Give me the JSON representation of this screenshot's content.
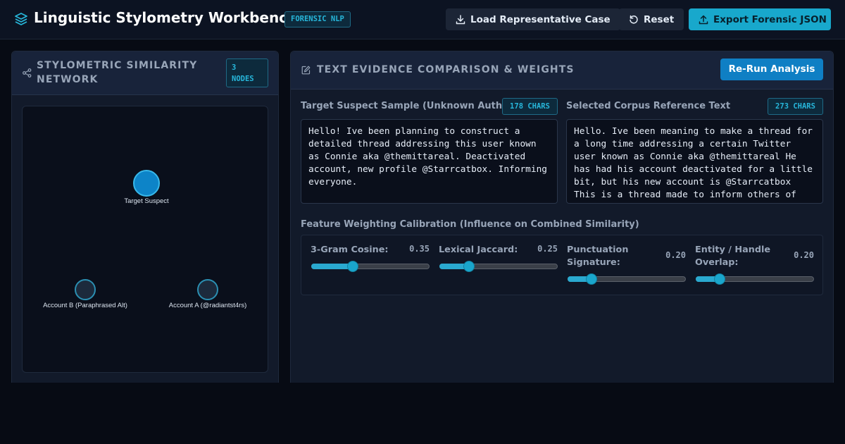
{
  "header": {
    "title": "Linguistic Stylometry Workbench",
    "badge": "FORENSIC NLP",
    "load_label": "Load Representative Case",
    "reset_label": "Reset",
    "export_label": "Export Forensic JSON"
  },
  "network_panel": {
    "title": "STYLOMETRIC SIMILARITY NETWORK",
    "node_count": "3 NODES",
    "nodes": [
      {
        "label": "Target Suspect",
        "role": "target"
      },
      {
        "label": "Account B (Paraphrased Alt)",
        "role": "corpus"
      },
      {
        "label": "Account A (@radiantst4rs)",
        "role": "corpus"
      }
    ]
  },
  "comparison_panel": {
    "title": "TEXT EVIDENCE COMPARISON & WEIGHTS",
    "rerun_label": "Re-Run Analysis",
    "target": {
      "label": "Target Suspect Sample (Unknown Author)",
      "chars": "178 CHARS",
      "text": "Hello! Ive been planning to construct a detailed thread addressing this user known as Connie aka @themittareal. Deactivated account, new profile @Starrcatbox. Informing everyone."
    },
    "reference": {
      "label": "Selected Corpus Reference Text",
      "chars": "273 CHARS",
      "text": "Hello. Ive been meaning to make a thread for a long time addressing a certain Twitter user known as Connie aka @themittareal He has had his account deactivated for a little bit, but his new account is @Starrcatbox This is a thread made to inform others of"
    },
    "weights_title": "Feature Weighting Calibration (Influence on Combined Similarity)",
    "weights": [
      {
        "label": "3-Gram Cosine:",
        "value": "0.35",
        "fraction": 0.35
      },
      {
        "label": "Lexical Jaccard:",
        "value": "0.25",
        "fraction": 0.25
      },
      {
        "label": "Punctuation Signature:",
        "value": "0.20",
        "fraction": 0.2
      },
      {
        "label": "Entity / Handle Overlap:",
        "value": "0.20",
        "fraction": 0.2
      }
    ]
  },
  "colors": {
    "accent": "#18a8cc",
    "primary_button": "#0f7fc4",
    "background": "#070b14",
    "panel": "#121a2a"
  }
}
